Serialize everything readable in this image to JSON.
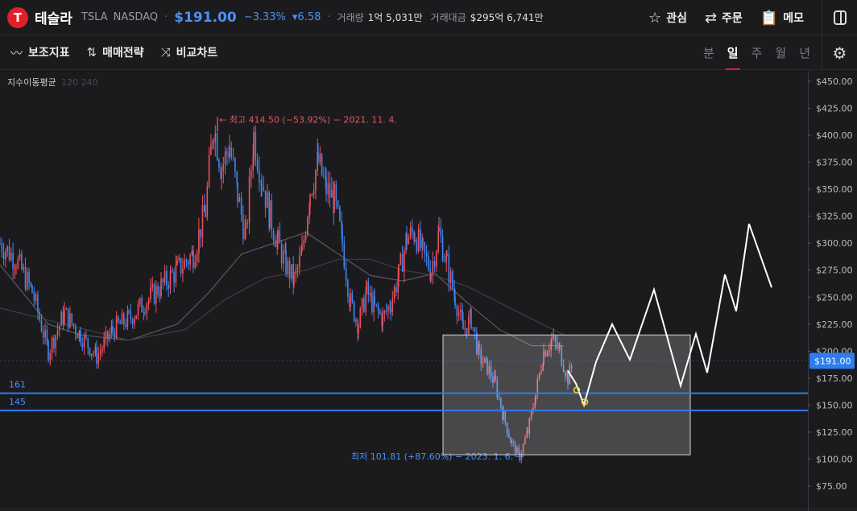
{
  "header": {
    "logo_letter": "T",
    "title": "테슬라",
    "symbol": "TSLA",
    "exchange": "NASDAQ",
    "price": "$191.00",
    "change_pct": "−3.33%",
    "change_abs": "▾6.58",
    "volume_label": "거래량",
    "volume_value": "1억 5,031만",
    "turnover_label": "거래대금",
    "turnover_value": "$295억 6,741만",
    "actions": {
      "watch": "관심",
      "order": "주문",
      "memo": "메모"
    }
  },
  "toolbar": {
    "indicators": "보조지표",
    "strategy": "매매전략",
    "compare": "비교차트",
    "periods": [
      "분",
      "일",
      "주",
      "월",
      "년"
    ],
    "active_period": "일"
  },
  "chart_data": {
    "type": "candlestick",
    "overlay_label": "지수이동평균",
    "overlay_params": "120 240",
    "y_ticks": [
      "$450.00",
      "$425.00",
      "$400.00",
      "$375.00",
      "$350.00",
      "$325.00",
      "$300.00",
      "$275.00",
      "$250.00",
      "$225.00",
      "$200.00",
      "$175.00",
      "$150.00",
      "$125.00",
      "$100.00",
      "$75.00"
    ],
    "ylim": [
      75,
      450
    ],
    "current_price_label": "$191.00",
    "current_price": 191,
    "high_annotation": "← 최고 414.50 (−53.92%) − 2021. 11. 4.",
    "high_value": 414.5,
    "low_annotation": "최저 101.81 (+87.60%) − 2023. 1. 6.  →",
    "low_value": 101.81,
    "horizontal_lines": [
      {
        "label": "161",
        "value": 161
      },
      {
        "label": "145",
        "value": 145
      }
    ],
    "box_range": [
      104,
      215
    ],
    "path_shape": [
      [
        0,
        300
      ],
      [
        20,
        285
      ],
      [
        40,
        255
      ],
      [
        60,
        200
      ],
      [
        80,
        235
      ],
      [
        100,
        215
      ],
      [
        120,
        195
      ],
      [
        140,
        220
      ],
      [
        160,
        230
      ],
      [
        180,
        245
      ],
      [
        200,
        260
      ],
      [
        220,
        275
      ],
      [
        240,
        290
      ],
      [
        255,
        330
      ],
      [
        265,
        410
      ],
      [
        275,
        370
      ],
      [
        285,
        390
      ],
      [
        295,
        345
      ],
      [
        305,
        305
      ],
      [
        315,
        400
      ],
      [
        325,
        360
      ],
      [
        335,
        325
      ],
      [
        345,
        300
      ],
      [
        355,
        280
      ],
      [
        365,
        265
      ],
      [
        375,
        290
      ],
      [
        385,
        350
      ],
      [
        395,
        375
      ],
      [
        405,
        350
      ],
      [
        415,
        340
      ],
      [
        425,
        300
      ],
      [
        435,
        245
      ],
      [
        445,
        225
      ],
      [
        455,
        255
      ],
      [
        465,
        240
      ],
      [
        475,
        230
      ],
      [
        485,
        245
      ],
      [
        495,
        270
      ],
      [
        505,
        305
      ],
      [
        515,
        310
      ],
      [
        525,
        290
      ],
      [
        535,
        275
      ],
      [
        545,
        310
      ],
      [
        555,
        280
      ],
      [
        565,
        250
      ],
      [
        575,
        220
      ],
      [
        585,
        230
      ],
      [
        595,
        195
      ],
      [
        605,
        185
      ],
      [
        615,
        170
      ],
      [
        625,
        140
      ],
      [
        635,
        115
      ],
      [
        645,
        102
      ],
      [
        655,
        125
      ],
      [
        665,
        160
      ],
      [
        675,
        200
      ],
      [
        685,
        210
      ],
      [
        695,
        200
      ],
      [
        705,
        175
      ],
      [
        710,
        185
      ]
    ],
    "ma_short": [
      [
        0,
        280
      ],
      [
        60,
        225
      ],
      [
        100,
        215
      ],
      [
        160,
        210
      ],
      [
        220,
        225
      ],
      [
        260,
        255
      ],
      [
        300,
        290
      ],
      [
        340,
        300
      ],
      [
        380,
        310
      ],
      [
        420,
        290
      ],
      [
        460,
        270
      ],
      [
        500,
        265
      ],
      [
        540,
        272
      ],
      [
        580,
        245
      ],
      [
        620,
        220
      ],
      [
        660,
        205
      ],
      [
        700,
        205
      ]
    ],
    "ma_long": [
      [
        0,
        240
      ],
      [
        80,
        225
      ],
      [
        160,
        210
      ],
      [
        230,
        220
      ],
      [
        280,
        248
      ],
      [
        330,
        268
      ],
      [
        380,
        275
      ],
      [
        420,
        285
      ],
      [
        460,
        285
      ],
      [
        500,
        275
      ],
      [
        540,
        270
      ],
      [
        580,
        260
      ],
      [
        620,
        245
      ],
      [
        660,
        230
      ],
      [
        700,
        215
      ]
    ],
    "projection": [
      [
        705,
        182
      ],
      [
        715,
        170
      ],
      [
        725,
        150
      ],
      [
        740,
        190
      ],
      [
        760,
        225
      ],
      [
        782,
        192
      ],
      [
        812,
        257
      ],
      [
        845,
        168
      ],
      [
        864,
        216
      ],
      [
        878,
        180
      ],
      [
        900,
        271
      ],
      [
        914,
        237
      ],
      [
        930,
        318
      ],
      [
        958,
        259
      ]
    ],
    "markers": [
      [
        716,
        164
      ],
      [
        726,
        153
      ]
    ]
  }
}
